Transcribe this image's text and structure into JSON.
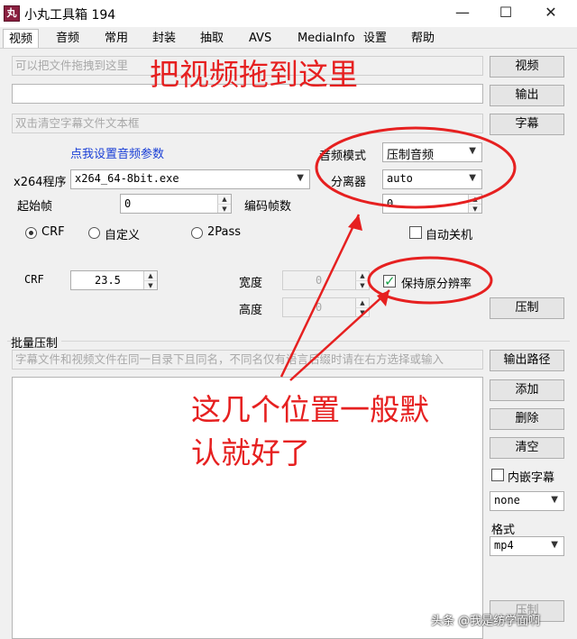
{
  "window": {
    "icon_glyph": "丸",
    "title": "小丸工具箱 194",
    "minimize": "—",
    "maximize": "☐",
    "close": "✕"
  },
  "tabs": [
    "视频",
    "音频",
    "常用",
    "封装",
    "抽取",
    "AVS",
    "MediaInfo",
    "设置",
    "帮助"
  ],
  "video": {
    "video_placeholder": "可以把文件拖拽到这里",
    "output_value": "",
    "subtitle_placeholder": "双击清空字幕文件文本框",
    "video_button": "视频",
    "output_button": "输出",
    "subtitle_button": "字幕",
    "audio_settings_link": "点我设置音频参数",
    "audio_mode_label": "音频模式",
    "audio_mode_value": "压制音频",
    "splitter_label": "分离器",
    "splitter_value": "auto",
    "x264_label": "x264程序",
    "x264_value": "x264_64-8bit.exe",
    "start_frame_label": "起始帧",
    "start_frame_value": "0",
    "encode_frames_label": "编码帧数",
    "encode_frames_value": "0",
    "mode_crf": "CRF",
    "mode_custom": "自定义",
    "mode_2pass": "2Pass",
    "auto_shutdown": "自动关机",
    "crf_label": "CRF",
    "crf_value": "23.5",
    "width_label": "宽度",
    "width_value": "0",
    "height_label": "高度",
    "height_value": "0",
    "keep_resolution": "保持原分辨率",
    "encode_button": "压制"
  },
  "batch": {
    "group_label": "批量压制",
    "hint": "字幕文件和视频文件在同一目录下且同名，不同名仅有语言后缀时请在右方选择或输入",
    "output_path_button": "输出路径",
    "add_button": "添加",
    "delete_button": "删除",
    "clear_button": "清空",
    "embed_subtitle": "内嵌字幕",
    "subtitle_lang_value": "none",
    "format_label": "格式",
    "format_value": "mp4",
    "bottom_button_partial": "压制"
  },
  "annotations": {
    "top": "把视频拖到这里",
    "bottom_line1": "这几个位置一般默",
    "bottom_line2": "认就好了",
    "color": "#e62020"
  },
  "watermark": "头条 @我是纺学面啊"
}
